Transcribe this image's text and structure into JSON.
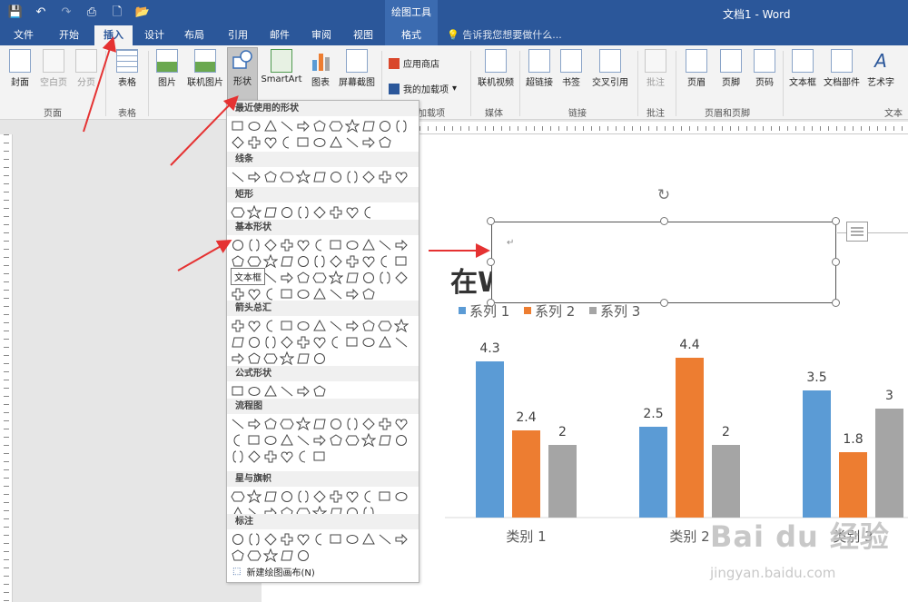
{
  "titlebar": {
    "tools_label": "绘图工具",
    "doc_title": "文档1 - Word",
    "qat": [
      "save-icon",
      "undo-icon",
      "redo-icon",
      "print-preview-icon",
      "new-doc-icon",
      "open-icon"
    ]
  },
  "tabs": [
    {
      "label": "文件"
    },
    {
      "label": "开始"
    },
    {
      "label": "插入"
    },
    {
      "label": "设计"
    },
    {
      "label": "布局"
    },
    {
      "label": "引用"
    },
    {
      "label": "邮件"
    },
    {
      "label": "审阅"
    },
    {
      "label": "视图"
    },
    {
      "label": "格式"
    }
  ],
  "active_tab": "插入",
  "tell_me": "告诉我您想要做什么...",
  "ribbon": {
    "buttons": {
      "cover": "封面",
      "blank": "空白页",
      "break": "分页",
      "table": "表格",
      "picture": "图片",
      "online_picture": "联机图片",
      "shapes": "形状",
      "smartart": "SmartArt",
      "chart": "图表",
      "screenshot": "屏幕截图",
      "store": "应用商店",
      "my_addins": "我的加载项",
      "online_video": "联机视频",
      "hyperlink": "超链接",
      "bookmark": "书签",
      "crossref": "交叉引用",
      "comment": "批注",
      "header": "页眉",
      "footer": "页脚",
      "page_number": "页码",
      "textbox": "文本框",
      "quickparts": "文档部件",
      "wordart": "艺术字"
    },
    "groups": {
      "pages": "页面",
      "tables": "表格",
      "addins": "加载项",
      "media": "媒体",
      "links": "链接",
      "comments": "批注",
      "header_footer": "页眉和页脚",
      "text": "文本"
    }
  },
  "shapes_menu": {
    "sections": [
      "最近使用的形状",
      "线条",
      "矩形",
      "基本形状",
      "箭头总汇",
      "公式形状",
      "流程图",
      "星与旗帜",
      "标注"
    ],
    "tooltip": "文本框",
    "new_canvas": "新建绘图画布(N)"
  },
  "document": {
    "heading_visible": "在W",
    "para_mark": "↵"
  },
  "chart_data": {
    "type": "bar",
    "categories": [
      "类别 1",
      "类别 2",
      "类别 3"
    ],
    "series": [
      {
        "name": "系列 1",
        "values": [
          4.3,
          2.5,
          3.5
        ],
        "color": "#5b9bd5"
      },
      {
        "name": "系列 2",
        "values": [
          2.4,
          4.4,
          1.8
        ],
        "color": "#ed7d31"
      },
      {
        "name": "系列 3",
        "values": [
          2,
          2,
          3
        ],
        "color": "#a5a5a5"
      }
    ],
    "ylim": [
      0,
      5
    ],
    "legend": "top-left",
    "grid": false
  },
  "watermark": {
    "logo": "Bai du 经验",
    "url": "jingyan.baidu.com"
  },
  "colors": {
    "accent": "#2b579a",
    "annotation_arrow": "#e53232"
  }
}
